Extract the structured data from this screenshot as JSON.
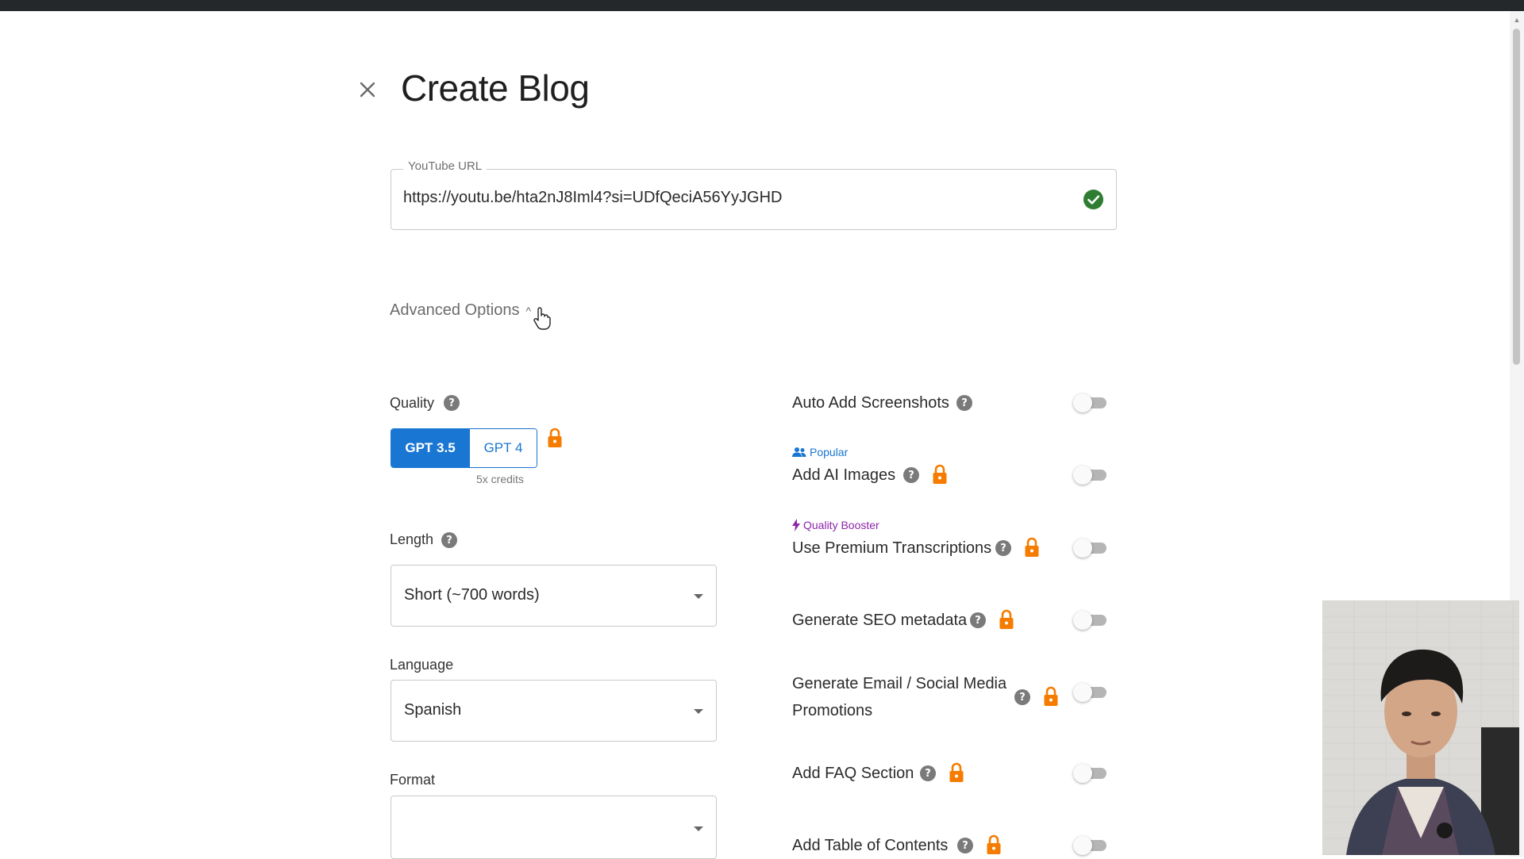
{
  "page": {
    "title": "Create Blog"
  },
  "youtube": {
    "label": "YouTube URL",
    "value": "https://youtu.be/hta2nJ8Iml4?si=UDfQeciA56YyJGHD"
  },
  "advanced": {
    "label": "Advanced Options",
    "chevron": "^"
  },
  "quality": {
    "label": "Quality",
    "options": [
      "GPT 3.5",
      "GPT 4"
    ],
    "selected": "GPT 3.5",
    "gpt4_note": "5x credits"
  },
  "length": {
    "label": "Length",
    "value": "Short (~700 words)"
  },
  "language": {
    "label": "Language",
    "value": "Spanish"
  },
  "format": {
    "label": "Format",
    "value": ""
  },
  "options": {
    "auto_screenshots": {
      "label": "Auto Add Screenshots",
      "enabled": false,
      "locked": false
    },
    "ai_images": {
      "tag": "Popular",
      "label": "Add AI Images",
      "enabled": false,
      "locked": true
    },
    "premium_transcriptions": {
      "tag": "Quality Booster",
      "label": "Use Premium Transcriptions",
      "enabled": false,
      "locked": true
    },
    "seo_metadata": {
      "label": "Generate SEO metadata",
      "enabled": false,
      "locked": true
    },
    "email_social_line1": "Generate Email / Social Media",
    "email_social_line2": "Promotions",
    "email_social": {
      "enabled": false,
      "locked": true
    },
    "faq": {
      "label": "Add FAQ Section",
      "enabled": false,
      "locked": true
    },
    "toc": {
      "label": "Add Table of Contents",
      "enabled": false,
      "locked": true
    }
  },
  "colors": {
    "accent": "#1976d2",
    "lock": "#f57c00",
    "check": "#2e7d32",
    "booster": "#8e24aa"
  },
  "icons": {
    "close": "close-icon",
    "valid": "check-circle-icon",
    "help": "help-icon",
    "lock": "lock-icon",
    "popular": "group-icon",
    "booster": "bolt-icon"
  }
}
